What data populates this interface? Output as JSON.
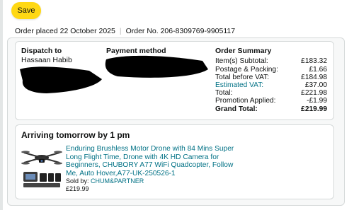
{
  "actions": {
    "save_label": "Save"
  },
  "order": {
    "placed": "Order placed 22 October 2025",
    "number": "Order No. 206-8309769-9905117"
  },
  "dispatch": {
    "heading": "Dispatch to",
    "name": "Hassaan Habib"
  },
  "payment": {
    "heading": "Payment method"
  },
  "summary": {
    "heading": "Order Summary",
    "rows": [
      {
        "label": "Item(s) Subtotal:",
        "value": "£183.32"
      },
      {
        "label": "Postage & Packing:",
        "value": "£1.66"
      },
      {
        "label": "Total before VAT:",
        "value": "£184.98"
      },
      {
        "label": "Estimated VAT:",
        "value": "£37.00"
      },
      {
        "label": "Total:",
        "value": "£221.98"
      },
      {
        "label": "Promotion Applied:",
        "value": "-£1.99"
      },
      {
        "label": "Grand Total:",
        "value": "£219.99"
      }
    ]
  },
  "shipment": {
    "arriving": "Arriving tomorrow by 1 pm",
    "product_title": "Enduring Brushless Motor Drone with 84 Mins Super Long Flight Time, Drone with 4K HD Camera for Beginners, CHUBORY A77 WiFi Quadcopter, Follow Me, Auto Hover,A77-UK-250526-1",
    "sold_by_label": "Sold by:",
    "seller": "CHUM&PARTNER",
    "price": "£219.99"
  },
  "colors": {
    "accent_button": "#ffd814",
    "link": "#007185"
  }
}
